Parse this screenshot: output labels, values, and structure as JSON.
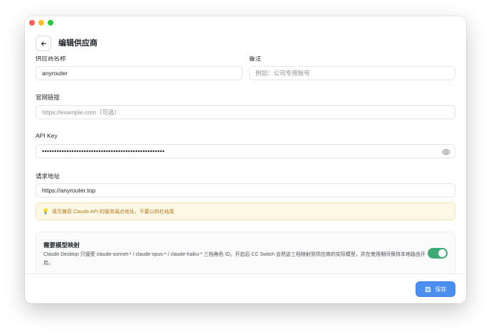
{
  "header": {
    "title": "编辑供应商"
  },
  "form": {
    "name_label": "供应商名称",
    "name_value": "anyrouter",
    "notes_label": "备注",
    "notes_placeholder": "例如：公司专用账号",
    "website_label": "官网链接",
    "website_placeholder": "https://example.com（可选）",
    "api_key_label": "API Key",
    "api_key_value": "••••••••••••••••••••••••••••••••••••••••••••••••••",
    "endpoint_label": "请求地址",
    "endpoint_value": "https://anyrouter.top",
    "hint": "填写兼容 Claude API 的服务端点地址，不要以斜杠结尾"
  },
  "mapping": {
    "title": "需要模型映射",
    "description": "Claude Desktop 只接受 claude-sonnet-* / claude-opus-* / claude-haiku-* 三档角色 ID。开启后 CC Switch 会把这三档映射到供应商的实际模型，并在使用期间保持本地路由开启。",
    "enabled": true
  },
  "footer": {
    "save_label": "保存"
  },
  "colors": {
    "accent": "#4a8ef0",
    "toggle_on": "#3daa75",
    "hint_bg": "#fef9e7",
    "hint_text": "#b7791f"
  },
  "icons": {
    "back": "arrow-left-icon",
    "eye": "eye-icon",
    "save": "save-icon",
    "hint": "lightbulb-icon"
  }
}
